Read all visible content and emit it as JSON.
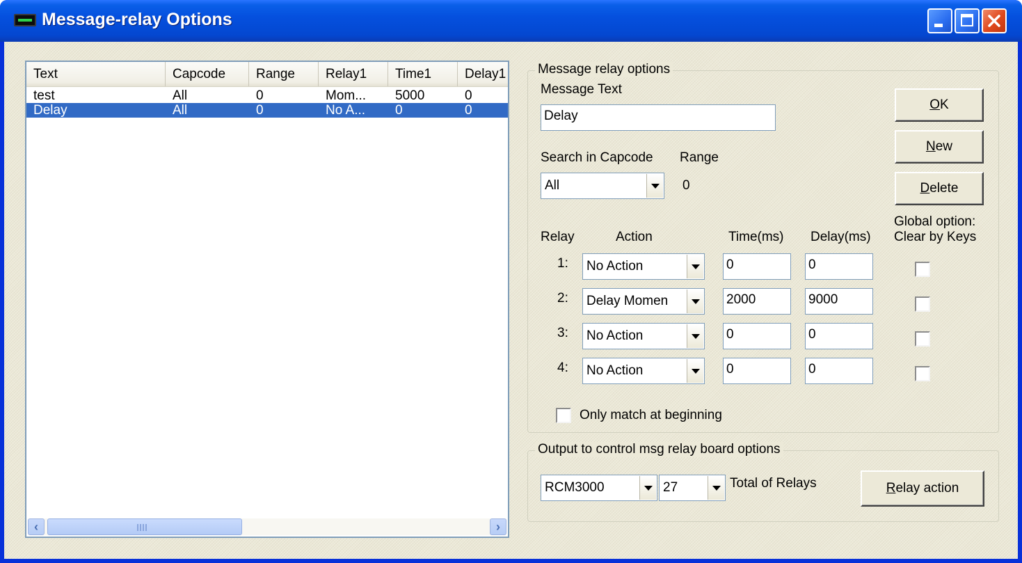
{
  "window": {
    "title": "Message-relay Options"
  },
  "list": {
    "columns": [
      "Text",
      "Capcode",
      "Range",
      "Relay1",
      "Time1",
      "Delay1"
    ],
    "rows": [
      [
        "test",
        "All",
        "0",
        "Mom...",
        "5000",
        "0"
      ],
      [
        "Delay",
        "All",
        "0",
        "No A...",
        "0",
        "0"
      ]
    ],
    "selected_row": 1
  },
  "message_group": {
    "label": "Message relay options",
    "message_text_label": "Message Text",
    "message_text_value": "Delay",
    "search_capcode_label": "Search in Capcode",
    "search_capcode_value": "All",
    "range_label": "Range",
    "range_value": "0",
    "headers": {
      "relay": "Relay",
      "action": "Action",
      "time": "Time(ms)",
      "delay": "Delay(ms)",
      "global_1": "Global option:",
      "global_2": "Clear by Keys"
    },
    "relays": [
      {
        "num": "1:",
        "action": "No Action",
        "time": "0",
        "delay": "0"
      },
      {
        "num": "2:",
        "action": "Delay Momen",
        "time": "2000",
        "delay": "9000"
      },
      {
        "num": "3:",
        "action": "No Action",
        "time": "0",
        "delay": "0"
      },
      {
        "num": "4:",
        "action": "No Action",
        "time": "0",
        "delay": "0"
      }
    ],
    "only_match_label": "Only match at beginning"
  },
  "buttons": {
    "ok_prefix": "",
    "ok_accel": "O",
    "ok_rest": "K",
    "new_prefix": "",
    "new_accel": "N",
    "new_rest": "ew",
    "delete_prefix": "",
    "delete_accel": "D",
    "delete_rest": "elete",
    "relay_action_prefix": "",
    "relay_action_accel": "R",
    "relay_action_rest": "elay action"
  },
  "output_group": {
    "label": "Output to control msg relay board options",
    "board_value": "RCM3000",
    "count_value": "27",
    "total_label": "Total of Relays"
  },
  "icons": {
    "title_icon": "terminal-icon",
    "minimize": "minimize-icon",
    "maximize": "maximize-icon",
    "close": "close-icon",
    "scroll_left": "chevron-left-icon",
    "scroll_right": "chevron-right-icon",
    "dropdown": "chevron-down-icon"
  },
  "colors": {
    "titlebar": "#0550de",
    "selection": "#316ac5",
    "close_button": "#e0481c",
    "dialog_bg": "#ece9d8"
  }
}
